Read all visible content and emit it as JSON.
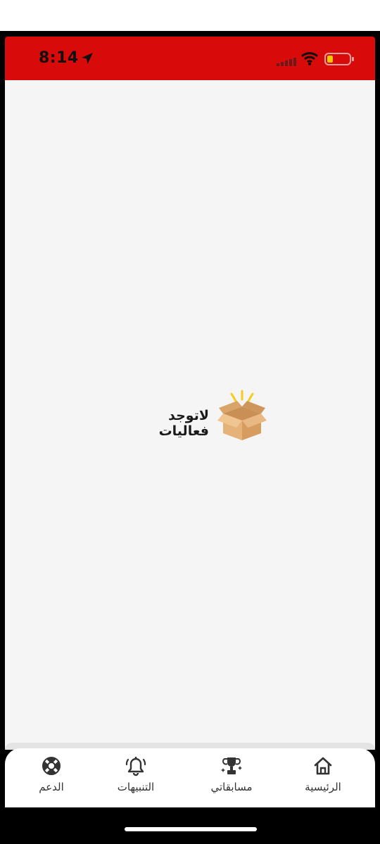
{
  "status_bar": {
    "time": "8:14",
    "location_icon": "location-arrow-icon",
    "signal_icon": "cellular-signal-icon",
    "wifi_icon": "wifi-icon",
    "battery_icon": "battery-low-icon",
    "battery_level": 0.2,
    "background_color": "#d80a0a"
  },
  "main": {
    "empty_message": "لاتوجد فعاليات",
    "empty_icon": "open-box-icon"
  },
  "tabbar": {
    "tabs": [
      {
        "label": "الرئيسية",
        "icon": "home-icon"
      },
      {
        "label": "مسابقاتي",
        "icon": "trophy-icon"
      },
      {
        "label": "التنبيهات",
        "icon": "bell-icon"
      },
      {
        "label": "الدعم",
        "icon": "lifebuoy-icon"
      }
    ]
  }
}
